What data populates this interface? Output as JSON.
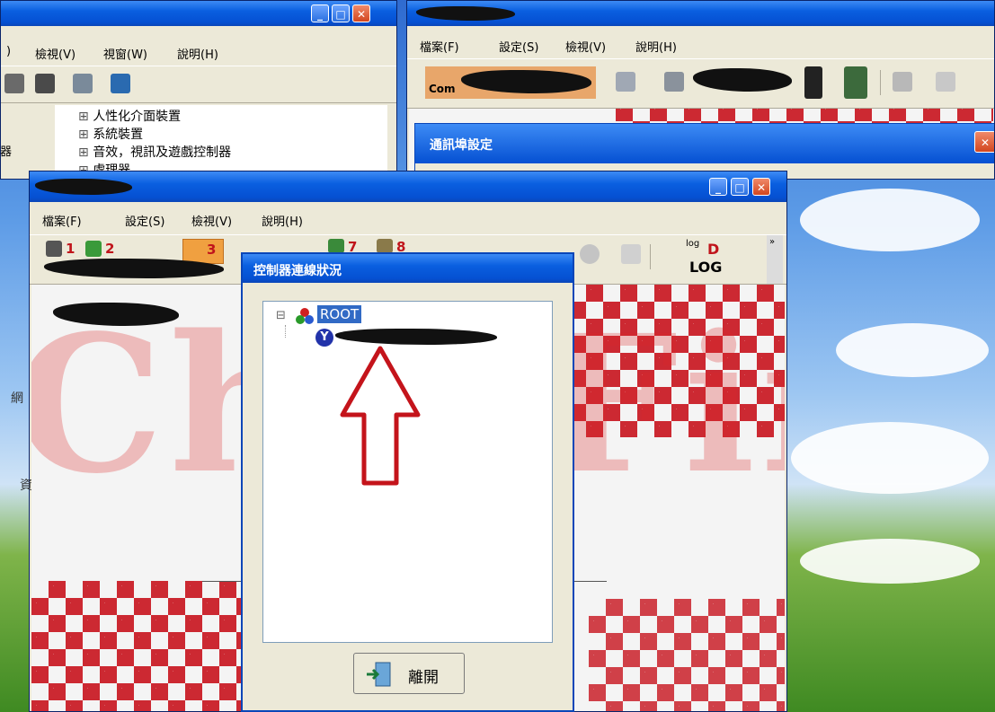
{
  "back_left_window": {
    "menu": [
      "檢視(V)",
      "視窗(W)",
      "說明(H)"
    ],
    "menu_prefix": ")",
    "tree_items": [
      "人性化介面裝置",
      "系統裝置",
      "音效，視訊及遊戲控制器",
      "處理器"
    ],
    "side_chars": [
      "器",
      "網",
      "資"
    ]
  },
  "back_right_window": {
    "menu": [
      "檔案(F)",
      "設定(S)",
      "檢視(V)",
      "說明(H)"
    ],
    "com_label": "Com",
    "sub_dialog_title": "通訊埠設定",
    "close_glyph": "✕"
  },
  "main_window": {
    "menu": [
      "檔案(F)",
      "設定(S)",
      "檢視(V)",
      "說明(H)"
    ],
    "toolbar": {
      "btn1_num": "1",
      "btn2_num": "2",
      "btn3_num": "3",
      "btn7_num": "7",
      "btn8_num": "8",
      "log_small": "log",
      "log_d": "D",
      "log_label": "LOG",
      "overflow": "»"
    },
    "watermark": "CharFing"
  },
  "dialog": {
    "title": "控制器連線狀況",
    "tree": {
      "expander": "⊟",
      "root_label": "ROOT",
      "child_icon_letter": "Y"
    },
    "exit_button_label": "離開"
  },
  "window_buttons": {
    "minimize": "_",
    "maximize": "□",
    "close": "✕"
  },
  "colors": {
    "accent": "#0a5fe0",
    "arrow": "#c4141b",
    "checker": "#c8141e"
  }
}
